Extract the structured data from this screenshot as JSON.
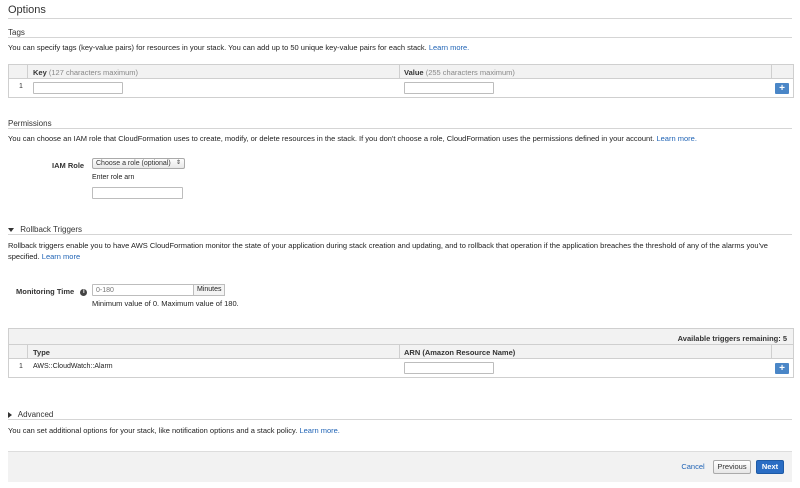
{
  "page_title": "Options",
  "tags": {
    "header": "Tags",
    "description": "You can specify tags (key-value pairs) for resources in your stack. You can add up to 50 unique key-value pairs for each stack.",
    "learn_more": "Learn more.",
    "col_key": "Key",
    "col_key_hint": "(127 characters maximum)",
    "col_value": "Value",
    "col_value_hint": "(255 characters maximum)",
    "row_number": "1",
    "add_label": "+"
  },
  "permissions": {
    "header": "Permissions",
    "description": "You can choose an IAM role that CloudFormation uses to create, modify, or delete resources in the stack. If you don't choose a role, CloudFormation uses the permissions defined in your account.",
    "learn_more": "Learn more.",
    "iam_role_label": "IAM Role",
    "role_select_value": "Choose a role (optional)",
    "enter_arn_label": "Enter role arn"
  },
  "rollback": {
    "header": "Rollback Triggers",
    "description": "Rollback triggers enable you to have AWS CloudFormation monitor the state of your application during stack creation and updating, and to rollback that operation if the application breaches the threshold of any of the alarms you've specified.",
    "learn_more": "Learn more",
    "monitoring_label": "Monitoring Time",
    "monitoring_placeholder": "0-180",
    "minutes_label": "Minutes",
    "range_hint": "Minimum value of 0. Maximum value of 180.",
    "available_label": "Available triggers remaining: 5",
    "col_type": "Type",
    "col_arn": "ARN (Amazon Resource Name)",
    "row_number": "1",
    "row_type": "AWS::CloudWatch::Alarm",
    "add_label": "+"
  },
  "advanced": {
    "header": "Advanced",
    "description": "You can set additional options for your stack, like notification options and a stack policy.",
    "learn_more": "Learn more."
  },
  "footer": {
    "cancel": "Cancel",
    "previous": "Previous",
    "next": "Next"
  },
  "colors": {
    "accent": "#1f63b5",
    "add_button": "#4a86c7",
    "next_button": "#2a6dc4"
  }
}
